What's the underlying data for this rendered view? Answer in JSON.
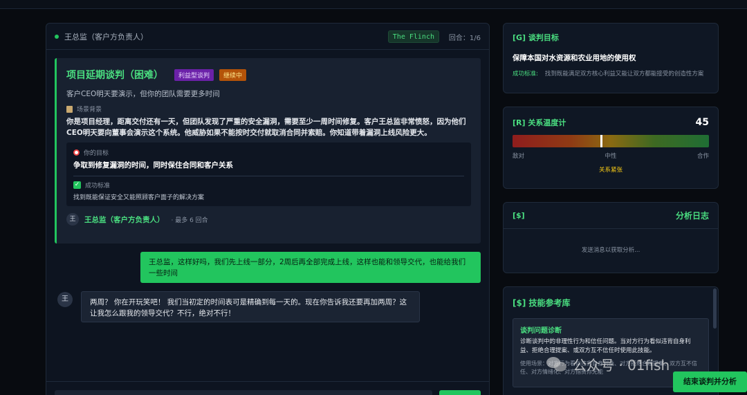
{
  "chat": {
    "header_name": "王总监（客户方负责人）",
    "mode_badge": "The Flinch",
    "round_text": "回合：1/6"
  },
  "scenario": {
    "title": "项目延期谈判（困难）",
    "tag_type": "利益型谈判",
    "tag_status": "继续中",
    "subtitle": "客户CEO明天要演示，但你的团队需要更多时间",
    "background_label": "场景背景",
    "background_text": "你是项目经理，距离交付还有一天，但团队发现了严重的安全漏洞，需要至少一周时间修复。客户王总监非常愤怒，因为他们CEO明天要向董事会演示这个系统。他威胁如果不能按时交付就取消合同并索赔。你知道带着漏洞上线风险更大。",
    "goal_label": "你的目标",
    "goal_text": "争取到修复漏洞的时间，同时保住合同和客户关系",
    "success_label": "成功标准",
    "success_text": "找到既能保证安全又能照顾客户面子的解决方案",
    "avatar_char": "王",
    "counterpart": "王总监（客户方负责人）",
    "max_rounds": "· 最多 6 回合"
  },
  "messages": {
    "user_text": "王总监，这样好吗，我们先上线一部分，2周后再全部完成上线，这样也能和领导交代，也能给我们一些时间",
    "ai_avatar": "王",
    "ai_text": "两周？ 你在开玩笑吧！ 我们当初定的时间表可是精确到每一天的。现在你告诉我还要再加两周？这让我怎么跟我的领导交代？不行，绝对不行！"
  },
  "goal_card": {
    "title": "[G] 谈判目标",
    "main": "保障本国对水资源和农业用地的使用权",
    "crit_key": "成功标准:",
    "crit_val": "找到既能满足双方核心利益又能让双方都能接受的创造性方案"
  },
  "temperature": {
    "title": "[R] 关系温度计",
    "value": 45,
    "value_text": "45",
    "scale_left": "敌对",
    "scale_mid": "中性",
    "scale_right": "合作",
    "status": "关系紧张"
  },
  "log": {
    "symbol": "[$]",
    "title": "分析日志",
    "empty": "发送消息以获取分析..."
  },
  "skills": {
    "title": "[$] 技能参考库",
    "item_name": "谈判问题诊断",
    "item_desc": "诊断谈判中的非理性行为和信任问题。当对方行为看似违背自身利益、拒绝合理提案、或双方互不信任时使用此技能。",
    "item_use": "使用场景：对方行为看似违背自身利益、对方拒绝合理提案、双方互不信任、对方情绪化、对方指责你无能"
  },
  "end_button": "结束谈判并分析",
  "watermark": "公众号 · 01fish"
}
